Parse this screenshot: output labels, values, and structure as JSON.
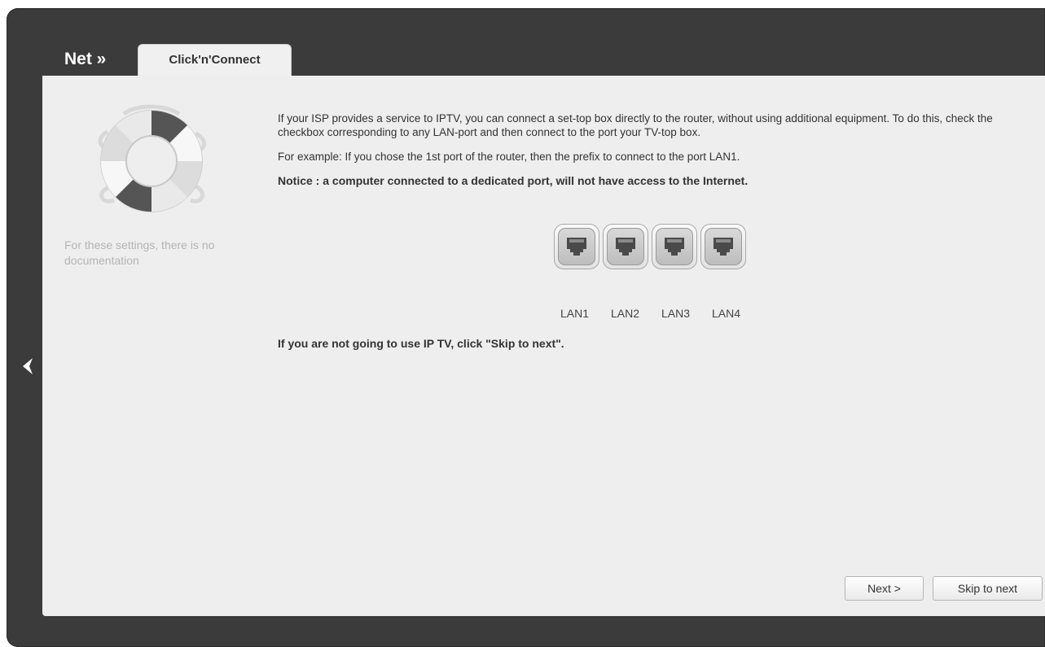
{
  "header": {
    "breadcrumb": "Net »",
    "active_tab": "Click'n'Connect"
  },
  "sidebar": {
    "icon": "lifebuoy-icon",
    "no_doc_text": "For these settings, there is no documentation"
  },
  "main": {
    "intro": "If your ISP provides a service to IPTV, you can connect a set-top box directly to the router, without using additional equipment. To do this, check the checkbox corresponding to any LAN-port and then connect to the port your TV-top box.",
    "example": "For example: If you chose the 1st port of the router, then the prefix to connect to the port LAN1.",
    "notice": "Notice : a computer connected to a dedicated port, will not have access to the Internet.",
    "ports": [
      {
        "label": "LAN1",
        "icon": "ethernet-port-icon"
      },
      {
        "label": "LAN2",
        "icon": "ethernet-port-icon"
      },
      {
        "label": "LAN3",
        "icon": "ethernet-port-icon"
      },
      {
        "label": "LAN4",
        "icon": "ethernet-port-icon"
      }
    ],
    "skip_note": "If you are not going to use IP TV, click \"Skip to next\"."
  },
  "buttons": {
    "next": "Next >",
    "skip": "Skip to next"
  },
  "colors": {
    "frame": "#3b3b3b",
    "panel": "#eeeeee",
    "text": "#333333",
    "muted": "#b4b4b4"
  }
}
